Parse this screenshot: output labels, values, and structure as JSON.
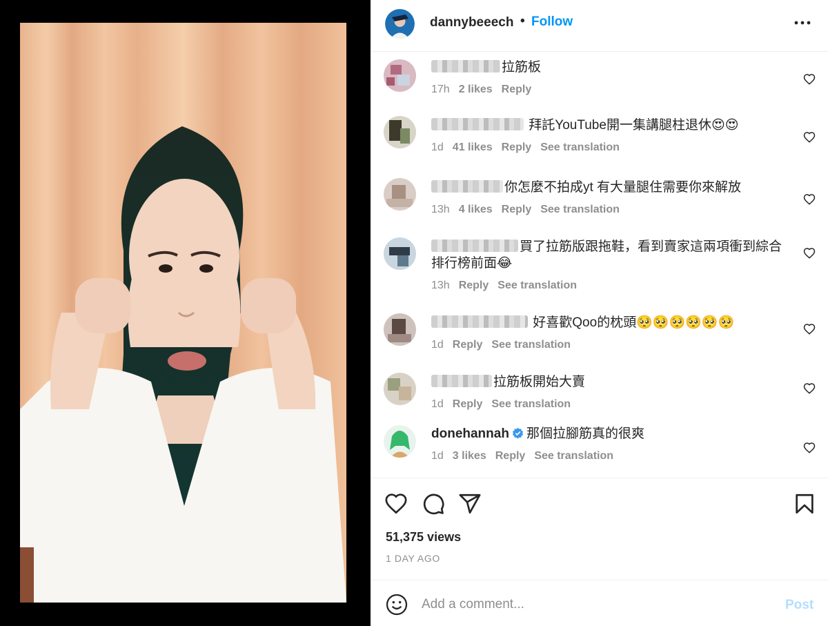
{
  "post": {
    "username": "dannybeeech",
    "separator": "•",
    "follow_label": "Follow",
    "views": "51,375 views",
    "date": "1 DAY AGO"
  },
  "comments": [
    {
      "text": "拉筋板",
      "time": "17h",
      "likes": "2 likes",
      "reply": "Reply"
    },
    {
      "text": " 拜託YouTube開一集講腿柱退休😍😍",
      "time": "1d",
      "likes": "41 likes",
      "reply": "Reply",
      "translate": "See translation"
    },
    {
      "text": "你怎麼不拍成yt 有大量腿住需要你來解放",
      "time": "13h",
      "likes": "4 likes",
      "reply": "Reply",
      "translate": "See translation"
    },
    {
      "text": "買了拉筋版跟拖鞋，看到賣家這兩項衝到綜合排行榜前面😂",
      "time": "13h",
      "reply": "Reply",
      "translate": "See translation"
    },
    {
      "text": " 好喜歡Qoo的枕頭🥺🥺🥺🥺🥺🥺",
      "time": "1d",
      "reply": "Reply",
      "translate": "See translation"
    },
    {
      "text": "拉筋板開始大賣",
      "time": "1d",
      "reply": "Reply",
      "translate": "See translation"
    },
    {
      "username": "donehannah",
      "text": "那個拉腳筋真的很爽",
      "time": "1d",
      "likes": "3 likes",
      "reply": "Reply",
      "translate": "See translation"
    }
  ],
  "compose": {
    "emoji_icon": "smiley-icon",
    "placeholder": "Add a comment...",
    "post_label": "Post"
  },
  "icons": [
    "more-icon",
    "heart-icon",
    "comment-icon",
    "share-icon",
    "bookmark-icon",
    "verified-icon"
  ],
  "colors": {
    "accent": "#0095f6",
    "post_disabled": "#b2dffc",
    "secondary_text": "#8e8e8e"
  }
}
